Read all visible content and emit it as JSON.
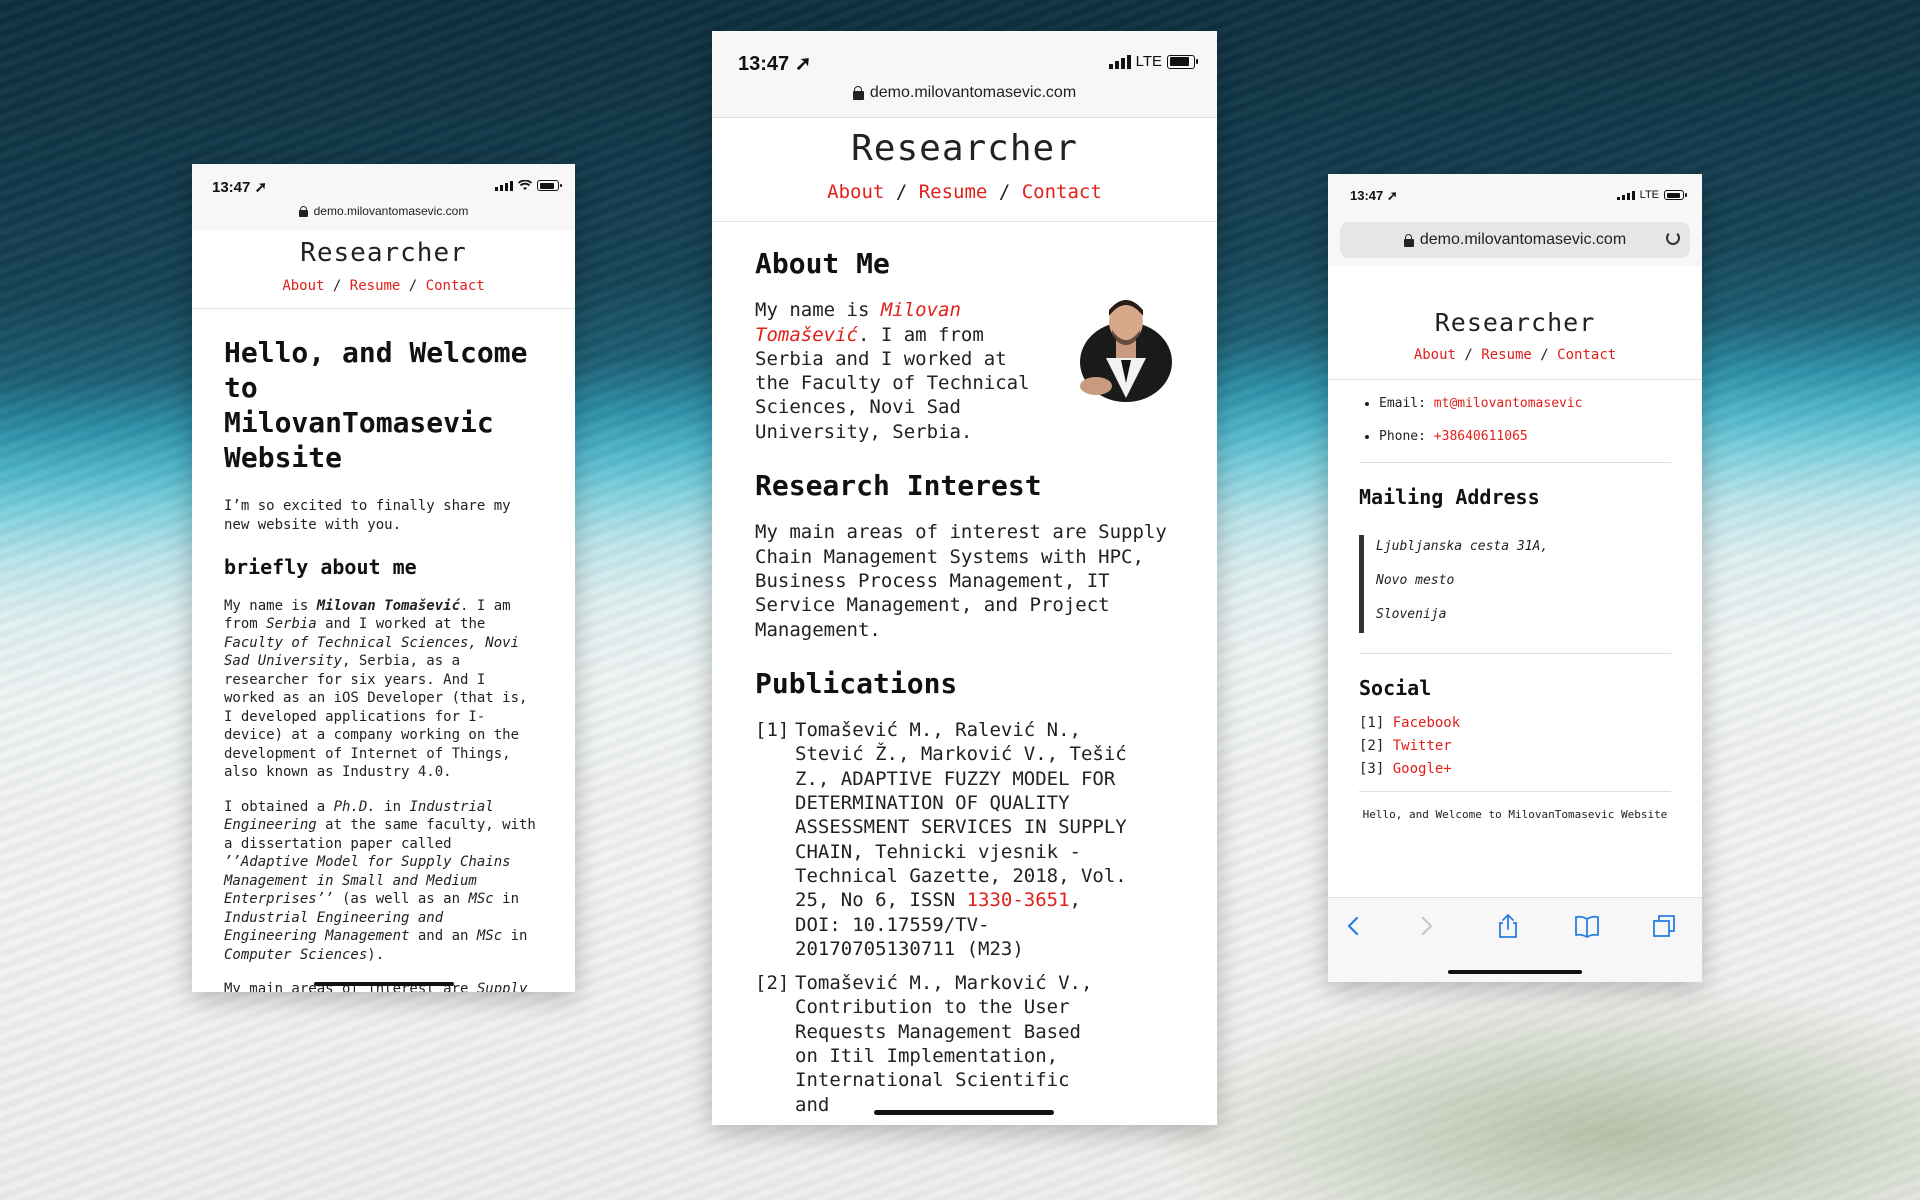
{
  "status": {
    "time": "13:47",
    "network": "LTE"
  },
  "url": "demo.milovantomasevic.com",
  "site": {
    "title": "Researcher",
    "nav": [
      "About",
      "Resume",
      "Contact"
    ],
    "nav_sep": "/"
  },
  "phone1": {
    "heading": "Hello, and Welcome to MilovanTomasevic Website",
    "intro": "I’m so excited to finally share my new website with you.",
    "subheading": "briefly about me",
    "p1": {
      "a": "My name is ",
      "name": "Milovan Tomašević",
      "b": ". I am from ",
      "country": "Serbia",
      "c": " and I worked at the ",
      "faculty": "Faculty of Technical Sciences, Novi Sad University",
      "d": ", Serbia, as a researcher for six years. And I worked as an iOS Developer (that is, I developed applications for I-device) at a company working on the development of Internet of Things, also known as Industry 4.0."
    },
    "p2": {
      "a": "I obtained a ",
      "phd": "Ph.D.",
      "b": " in ",
      "field": "Industrial Engineering",
      "c": " at the same faculty, with a dissertation paper called ",
      "thesis": "’’Adaptive Model for Supply Chains Management in Small and Medium Enterprises’’",
      "d": " (as well as an ",
      "msc1": "MSc",
      "e": " in ",
      "field2": "Industrial Engineering and Engineering Management",
      "f": " and an ",
      "msc2": "MSc",
      "g": " in ",
      "field3": "Computer Sciences",
      "h": ")."
    },
    "p3": {
      "a": "My main areas of interest are ",
      "areas": "Supply Chain Management Systems with HPC, Business Process Management, IT"
    }
  },
  "phone2": {
    "about_heading": "About Me",
    "about": {
      "a": "My name is ",
      "name": "Milovan Tomašević",
      "b": ". I am from Serbia and I worked at the Faculty of Technical Sciences, Novi Sad University, Serbia."
    },
    "research_heading": "Research Interest",
    "research_text": "My main areas of interest are Supply Chain Management Systems with HPC, Business Process Management, IT Service Management, and Project Management.",
    "publications_heading": "Publications",
    "pub1": {
      "num": "[1]",
      "a": "Tomašević M., Ralević N., Stević Ž., Marković V., Tešić Z., ADAPTIVE FUZZY MODEL FOR DETERMINATION OF QUALITY ASSESSMENT SERVICES IN SUPPLY CHAIN, Tehnicki vjesnik - Technical Gazette, 2018, Vol. 25, No 6, ISSN ",
      "issn": "1330-3651",
      "b": ", DOI: 10.17559/TV-20170705130711 (M23)"
    },
    "pub2": {
      "num": "[2]",
      "a": "Tomašević M., Marković V., Contribution to the User Requests Management Based on Itil Implementation, International Scientific and"
    }
  },
  "phone3": {
    "email_label": "Email: ",
    "email": "mt@milovantomasevic",
    "phone_label": "Phone: ",
    "phone": "+38640611065",
    "mailing_heading": "Mailing Address",
    "address": [
      "Ljubljanska cesta 31A,",
      "Novo mesto",
      "Slovenija"
    ],
    "social_heading": "Social",
    "social": [
      {
        "num": "[1]",
        "label": "Facebook"
      },
      {
        "num": "[2]",
        "label": "Twitter"
      },
      {
        "num": "[3]",
        "label": "Google+"
      }
    ],
    "footer": "Hello, and Welcome to MilovanTomasevic Website"
  },
  "colors": {
    "accent": "#e0201a",
    "text": "#222222"
  },
  "icons": [
    "location-arrow-icon",
    "signal-icon",
    "wifi-icon",
    "battery-icon",
    "lock-icon",
    "reload-icon",
    "back-icon",
    "forward-icon",
    "share-icon",
    "bookmarks-icon",
    "tabs-icon"
  ]
}
